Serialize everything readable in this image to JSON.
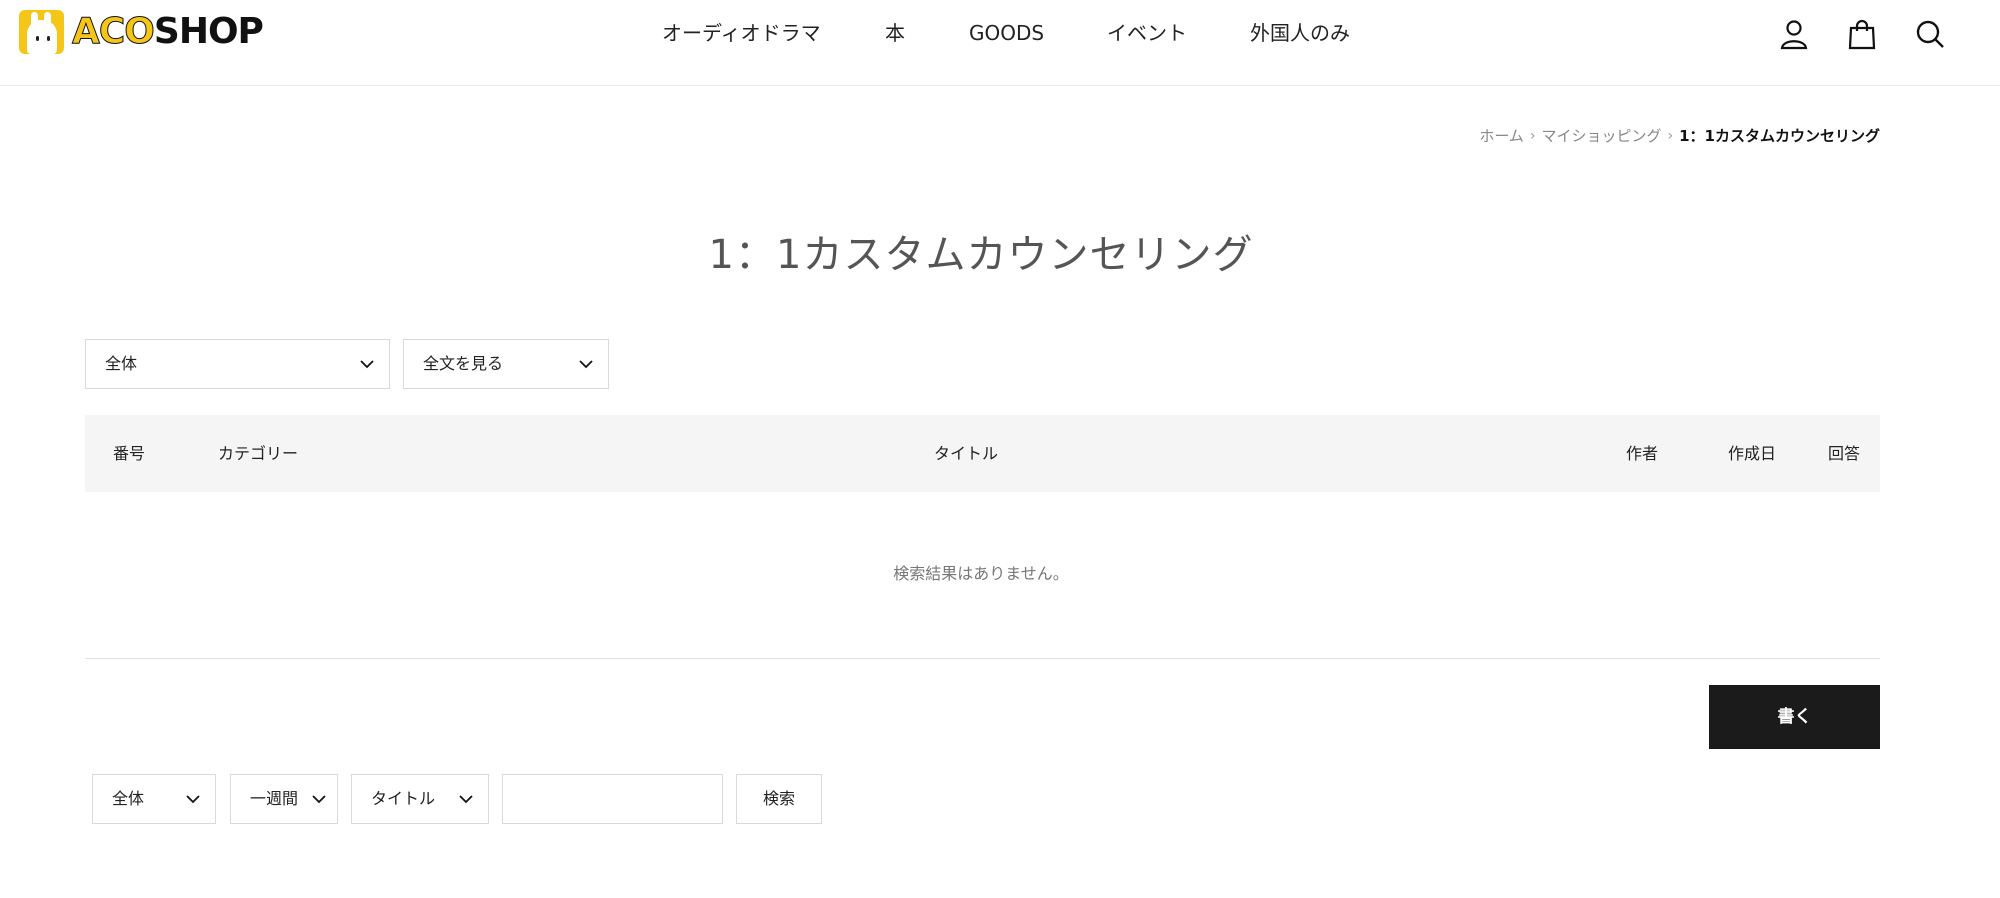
{
  "header": {
    "logo": {
      "text_aco": "ACO",
      "text_shop": "SHOP",
      "brand_color": "#f5c518"
    },
    "nav": [
      "オーディオドラマ",
      "本",
      "GOODS",
      "イベント",
      "外国人のみ"
    ],
    "icons": [
      "user-icon",
      "cart-icon",
      "search-icon"
    ]
  },
  "breadcrumb": {
    "items": [
      "ホーム",
      "マイショッピング"
    ],
    "current": "1：1カスタムカウンセリング"
  },
  "page": {
    "title": "1：1カスタムカウンセリング"
  },
  "filters": {
    "category": "全体",
    "view": "全文を見る"
  },
  "table": {
    "headers": {
      "no": "番号",
      "category": "カテゴリー",
      "title": "タイトル",
      "author": "作者",
      "date": "作成日",
      "reply": "回答"
    },
    "empty_message": "検索結果はありません。"
  },
  "actions": {
    "write_label": "書く"
  },
  "search": {
    "scope": "全体",
    "period": "一週間",
    "field": "タイトル",
    "query": "",
    "button_label": "検索"
  },
  "colors": {
    "write_button_bg": "#1b1b1b",
    "table_header_bg": "#f4f5f4"
  }
}
